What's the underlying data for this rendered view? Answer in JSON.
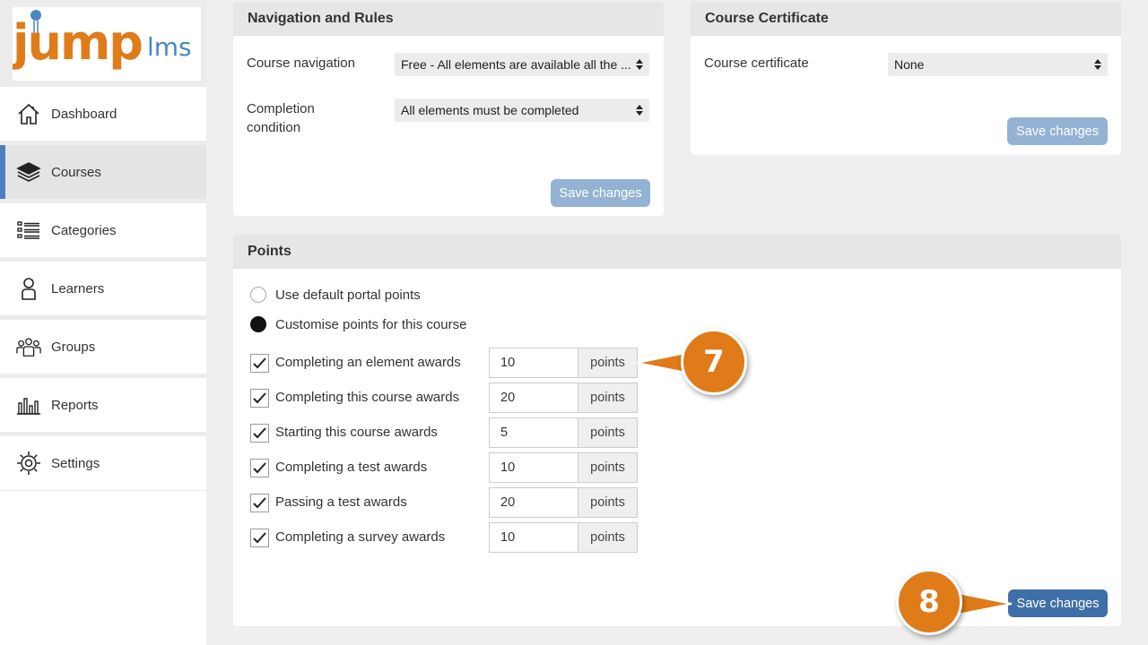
{
  "colors": {
    "accent_blue": "#3f6fa8",
    "disabled_blue": "#93b2d4",
    "active_indicator": "#4a7fc2",
    "logo_orange": "#e07b1a",
    "logo_blue": "#4a86c5",
    "callout_orange": "#e07b1a"
  },
  "logo": {
    "main": "jump",
    "suffix": "lms"
  },
  "sidebar": {
    "items": [
      {
        "label": "Dashboard",
        "icon": "home-icon"
      },
      {
        "label": "Courses",
        "icon": "books-icon",
        "active": true
      },
      {
        "label": "Categories",
        "icon": "list-icon"
      },
      {
        "label": "Learners",
        "icon": "person-icon"
      },
      {
        "label": "Groups",
        "icon": "group-icon"
      },
      {
        "label": "Reports",
        "icon": "bar-chart-icon"
      },
      {
        "label": "Settings",
        "icon": "gear-icon"
      }
    ]
  },
  "navigation_panel": {
    "title": "Navigation and Rules",
    "course_navigation_label": "Course navigation",
    "course_navigation_value": "Free - All elements are available all the ...",
    "completion_label_line1": "Completion",
    "completion_label_line2": "condition",
    "completion_value": "All elements must be completed",
    "save_label": "Save changes"
  },
  "certificate_panel": {
    "title": "Course Certificate",
    "certificate_label": "Course certificate",
    "certificate_value": "None",
    "save_label": "Save changes"
  },
  "points_panel": {
    "title": "Points",
    "radio_default": "Use default portal points",
    "radio_custom": "Customise points for this course",
    "selected": "custom",
    "unit": "points",
    "rows": [
      {
        "label": "Completing an element awards",
        "value": "10",
        "checked": true
      },
      {
        "label": "Completing this course awards",
        "value": "20",
        "checked": true
      },
      {
        "label": "Starting this course awards",
        "value": "5",
        "checked": true
      },
      {
        "label": "Completing a test awards",
        "value": "10",
        "checked": true
      },
      {
        "label": "Passing a test awards",
        "value": "20",
        "checked": true
      },
      {
        "label": "Completing a survey awards",
        "value": "10",
        "checked": true
      }
    ],
    "save_label": "Save changes"
  },
  "callouts": {
    "step7": "7",
    "step8": "8"
  }
}
